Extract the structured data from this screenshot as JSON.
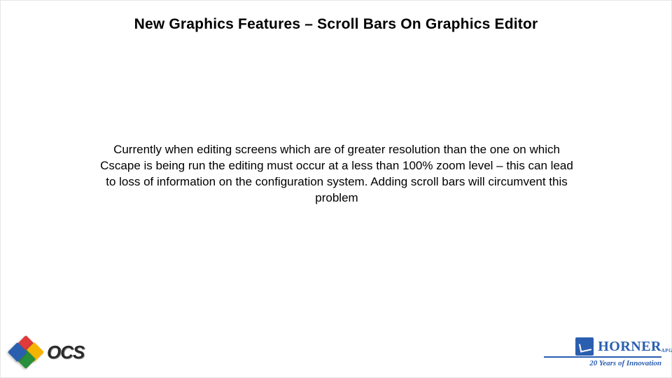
{
  "title": "New Graphics Features – Scroll Bars On Graphics Editor",
  "body": "Currently when editing screens  which are of greater resolution than the one on which Cscape is being run the editing must occur at a less than 100% zoom level – this can lead to loss of information on the configuration system. Adding scroll bars will circumvent this problem",
  "ocs": {
    "label": "OCS"
  },
  "horner": {
    "name": "HORNER",
    "apg": "APG",
    "tagline": "20 Years of Innovation"
  }
}
